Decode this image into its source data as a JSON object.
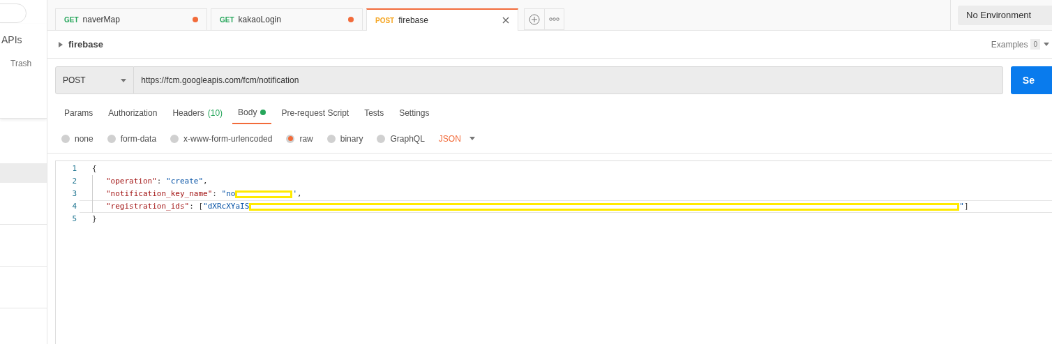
{
  "sidebar": {
    "items": [
      {
        "label": "APIs"
      },
      {
        "label": "Trash"
      }
    ],
    "rows": [
      {
        "selected": true
      },
      {
        "selected": false
      },
      {
        "selected": false
      },
      {
        "selected": false
      }
    ]
  },
  "tabs": [
    {
      "method": "GET",
      "name": "naverMap",
      "selected": false,
      "unsaved": true
    },
    {
      "method": "GET",
      "name": "kakaoLogin",
      "selected": false,
      "unsaved": true
    },
    {
      "method": "POST",
      "name": "firebase",
      "selected": true,
      "unsaved": false
    }
  ],
  "environment": "No Environment",
  "breadcrumb": "firebase",
  "examples": {
    "label": "Examples",
    "count": "0"
  },
  "request": {
    "method": "POST",
    "url": "https://fcm.googleapis.com/fcm/notification",
    "send": "Se"
  },
  "subtabs": [
    {
      "label": "Params",
      "selected": false,
      "dot": false
    },
    {
      "label": "Authorization",
      "selected": false,
      "dot": false
    },
    {
      "label": "Headers",
      "count": "(10)",
      "selected": false,
      "dot": false
    },
    {
      "label": "Body",
      "selected": true,
      "dot": true
    },
    {
      "label": "Pre-request Script",
      "selected": false,
      "dot": false
    },
    {
      "label": "Tests",
      "selected": false,
      "dot": false
    },
    {
      "label": "Settings",
      "selected": false,
      "dot": false
    }
  ],
  "body_types": [
    {
      "label": "none",
      "selected": false
    },
    {
      "label": "form-data",
      "selected": false
    },
    {
      "label": "x-www-form-urlencoded",
      "selected": false
    },
    {
      "label": "raw",
      "selected": true
    },
    {
      "label": "binary",
      "selected": false
    },
    {
      "label": "GraphQL",
      "selected": false
    }
  ],
  "format": "JSON",
  "code": [
    {
      "number": "1",
      "active": false,
      "tokens": [
        {
          "kind": "punct",
          "text": "{"
        }
      ]
    },
    {
      "number": "2",
      "active": false,
      "tokens": [
        {
          "kind": "key",
          "text": "\"operation\""
        },
        {
          "kind": "punct",
          "text": ": "
        },
        {
          "kind": "string",
          "text": "\"create\""
        },
        {
          "kind": "punct",
          "text": ","
        }
      ]
    },
    {
      "number": "3",
      "active": false,
      "tokens": [
        {
          "kind": "key",
          "text": "\"notification_key_name\""
        },
        {
          "kind": "punct",
          "text": ": "
        },
        {
          "kind": "string",
          "text": "\"no"
        },
        {
          "kind": "redaction",
          "wide": false
        },
        {
          "kind": "string",
          "text": "'"
        },
        {
          "kind": "punct",
          "text": ","
        }
      ]
    },
    {
      "number": "4",
      "active": true,
      "tokens": [
        {
          "kind": "key",
          "text": "\"registration_ids\""
        },
        {
          "kind": "punct",
          "text": ": "
        },
        {
          "kind": "punct",
          "text": "["
        },
        {
          "kind": "string",
          "text": "\"dXRcXYaIS"
        },
        {
          "kind": "redaction",
          "wide": true
        },
        {
          "kind": "string",
          "text": "\""
        },
        {
          "kind": "punct",
          "text": "]"
        }
      ]
    },
    {
      "number": "5",
      "active": false,
      "tokens": [
        {
          "kind": "punct",
          "text": "}"
        }
      ]
    }
  ]
}
